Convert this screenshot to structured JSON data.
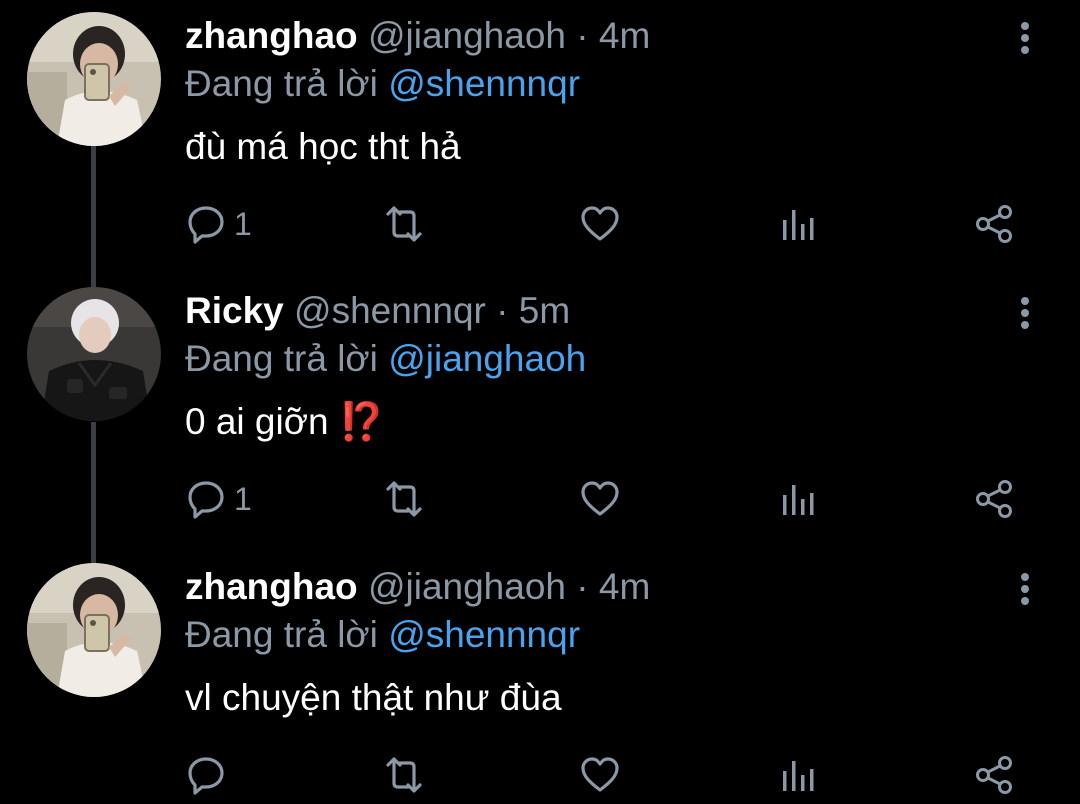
{
  "tweets": [
    {
      "name": "zhanghao",
      "handle": "@jianghaoh",
      "separator": "·",
      "time": "4m",
      "replying_prefix": "Đang trả lời",
      "replying_to": "@shennnqr",
      "text": "đù má học tht hả",
      "emoji": "",
      "reply_count": "1"
    },
    {
      "name": "Ricky",
      "handle": "@shennnqr",
      "separator": "·",
      "time": "5m",
      "replying_prefix": "Đang trả lời",
      "replying_to": "@jianghaoh",
      "text": "0 ai giỡn ",
      "emoji": "⁉️",
      "reply_count": "1"
    },
    {
      "name": "zhanghao",
      "handle": "@jianghaoh",
      "separator": "·",
      "time": "4m",
      "replying_prefix": "Đang trả lời",
      "replying_to": "@shennnqr",
      "text": "vl chuyện thật như đùa",
      "emoji": "",
      "reply_count": ""
    }
  ],
  "icons": {
    "more": "more-vertical-icon",
    "reply": "reply-bubble-icon",
    "retweet": "retweet-icon",
    "like": "heart-icon",
    "stats": "bar-chart-icon",
    "share": "share-icon"
  },
  "colors": {
    "background": "#000000",
    "text": "#ffffff",
    "muted": "#8b98a5",
    "mention": "#4aa3ee",
    "thread_line": "#3a3f44"
  }
}
